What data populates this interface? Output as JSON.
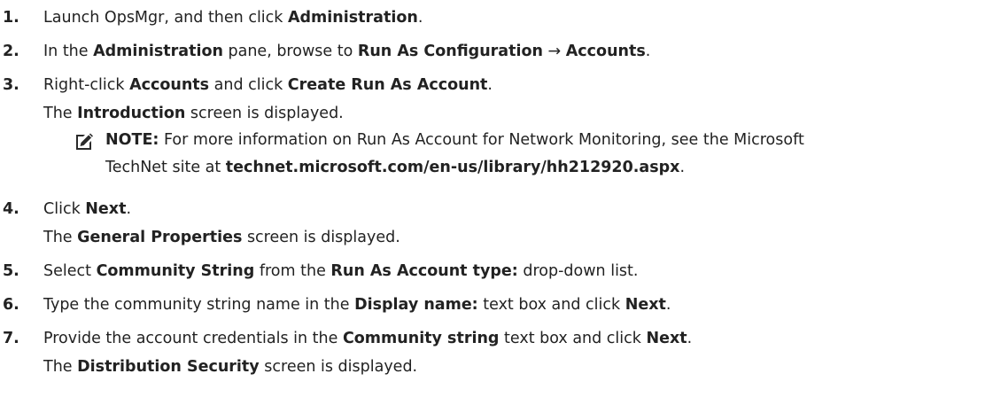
{
  "steps": [
    {
      "num": "1.",
      "parts": [
        {
          "t": "Launch OpsMgr, and then click "
        },
        {
          "t": "Administration",
          "b": true
        },
        {
          "t": "."
        }
      ]
    },
    {
      "num": "2.",
      "parts": [
        {
          "t": "In the "
        },
        {
          "t": "Administration",
          "b": true
        },
        {
          "t": " pane, browse to "
        },
        {
          "t": "Run As Configuration",
          "b": true
        },
        {
          "t": " → "
        },
        {
          "t": "Accounts",
          "b": true
        },
        {
          "t": "."
        }
      ]
    },
    {
      "num": "3.",
      "parts": [
        {
          "t": "Right-click "
        },
        {
          "t": "Accounts",
          "b": true
        },
        {
          "t": " and click "
        },
        {
          "t": "Create Run As Account",
          "b": true
        },
        {
          "t": "."
        }
      ],
      "sub": [
        {
          "t": "The "
        },
        {
          "t": "Introduction",
          "b": true
        },
        {
          "t": " screen is displayed."
        }
      ]
    },
    {
      "num": "4.",
      "parts": [
        {
          "t": "Click "
        },
        {
          "t": "Next",
          "b": true
        },
        {
          "t": "."
        }
      ],
      "sub": [
        {
          "t": "The "
        },
        {
          "t": "General Properties",
          "b": true
        },
        {
          "t": " screen is displayed."
        }
      ]
    },
    {
      "num": "5.",
      "parts": [
        {
          "t": "Select "
        },
        {
          "t": "Community String",
          "b": true
        },
        {
          "t": " from the "
        },
        {
          "t": "Run As Account type:",
          "b": true
        },
        {
          "t": " drop-down list."
        }
      ]
    },
    {
      "num": "6.",
      "parts": [
        {
          "t": "Type the community string name in the "
        },
        {
          "t": "Display name:",
          "b": true
        },
        {
          "t": " text box and click "
        },
        {
          "t": "Next",
          "b": true
        },
        {
          "t": "."
        }
      ]
    },
    {
      "num": "7.",
      "parts": [
        {
          "t": "Provide the account credentials in the "
        },
        {
          "t": "Community string",
          "b": true
        },
        {
          "t": " text box and click "
        },
        {
          "t": "Next",
          "b": true
        },
        {
          "t": "."
        }
      ],
      "sub": [
        {
          "t": "The "
        },
        {
          "t": "Distribution Security",
          "b": true
        },
        {
          "t": " screen is displayed."
        }
      ]
    }
  ],
  "note": {
    "label": "NOTE:",
    "line1": " For more information on Run As Account for Network Monitoring, see the Microsoft",
    "line2_prefix": "TechNet site at ",
    "link": "technet.microsoft.com/en-us/library/hh212920.aspx",
    "line2_suffix": ".",
    "icon": "pencil-note-icon"
  }
}
